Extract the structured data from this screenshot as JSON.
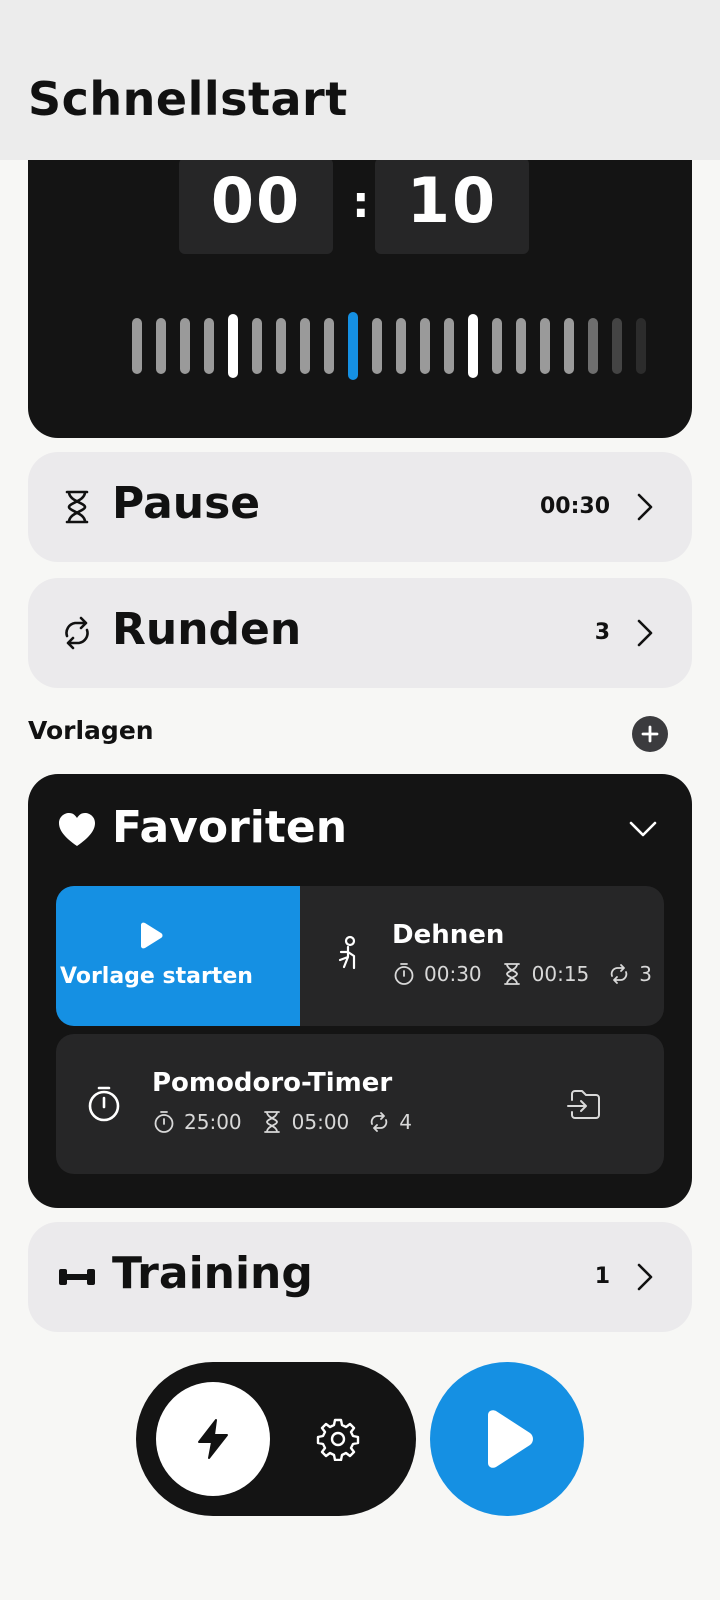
{
  "header": {
    "title": "Schnellstart"
  },
  "timer": {
    "minutes": "00",
    "seconds": "10",
    "separator": ":"
  },
  "rows": {
    "pause": {
      "label": "Pause",
      "value": "00:30",
      "icon": "hourglass-icon"
    },
    "rounds": {
      "label": "Runden",
      "value": "3",
      "icon": "repeat-icon"
    },
    "training": {
      "label": "Training",
      "value": "1",
      "icon": "dumbbell-icon"
    }
  },
  "templates": {
    "section_label": "Vorlagen",
    "add_icon": "plus-icon",
    "favorites": {
      "title": "Favoriten",
      "icon": "heart-icon",
      "items": [
        {
          "name": "Dehnen",
          "icon": "stretching-person-icon",
          "work": "00:30",
          "rest": "00:15",
          "rounds": "3",
          "swipe_action_label": "Vorlage starten"
        },
        {
          "name": "Pomodoro-Timer",
          "icon": "stopwatch-icon",
          "work": "25:00",
          "rest": "05:00",
          "rounds": "4",
          "action_icon": "folder-import-icon"
        }
      ]
    }
  },
  "bottom_bar": {
    "quick_icon": "lightning-icon",
    "settings_icon": "gear-icon",
    "start_icon": "play-icon"
  },
  "colors": {
    "accent": "#1590e3",
    "dark": "#141414",
    "card": "#ebeaec",
    "tile": "#262627"
  }
}
